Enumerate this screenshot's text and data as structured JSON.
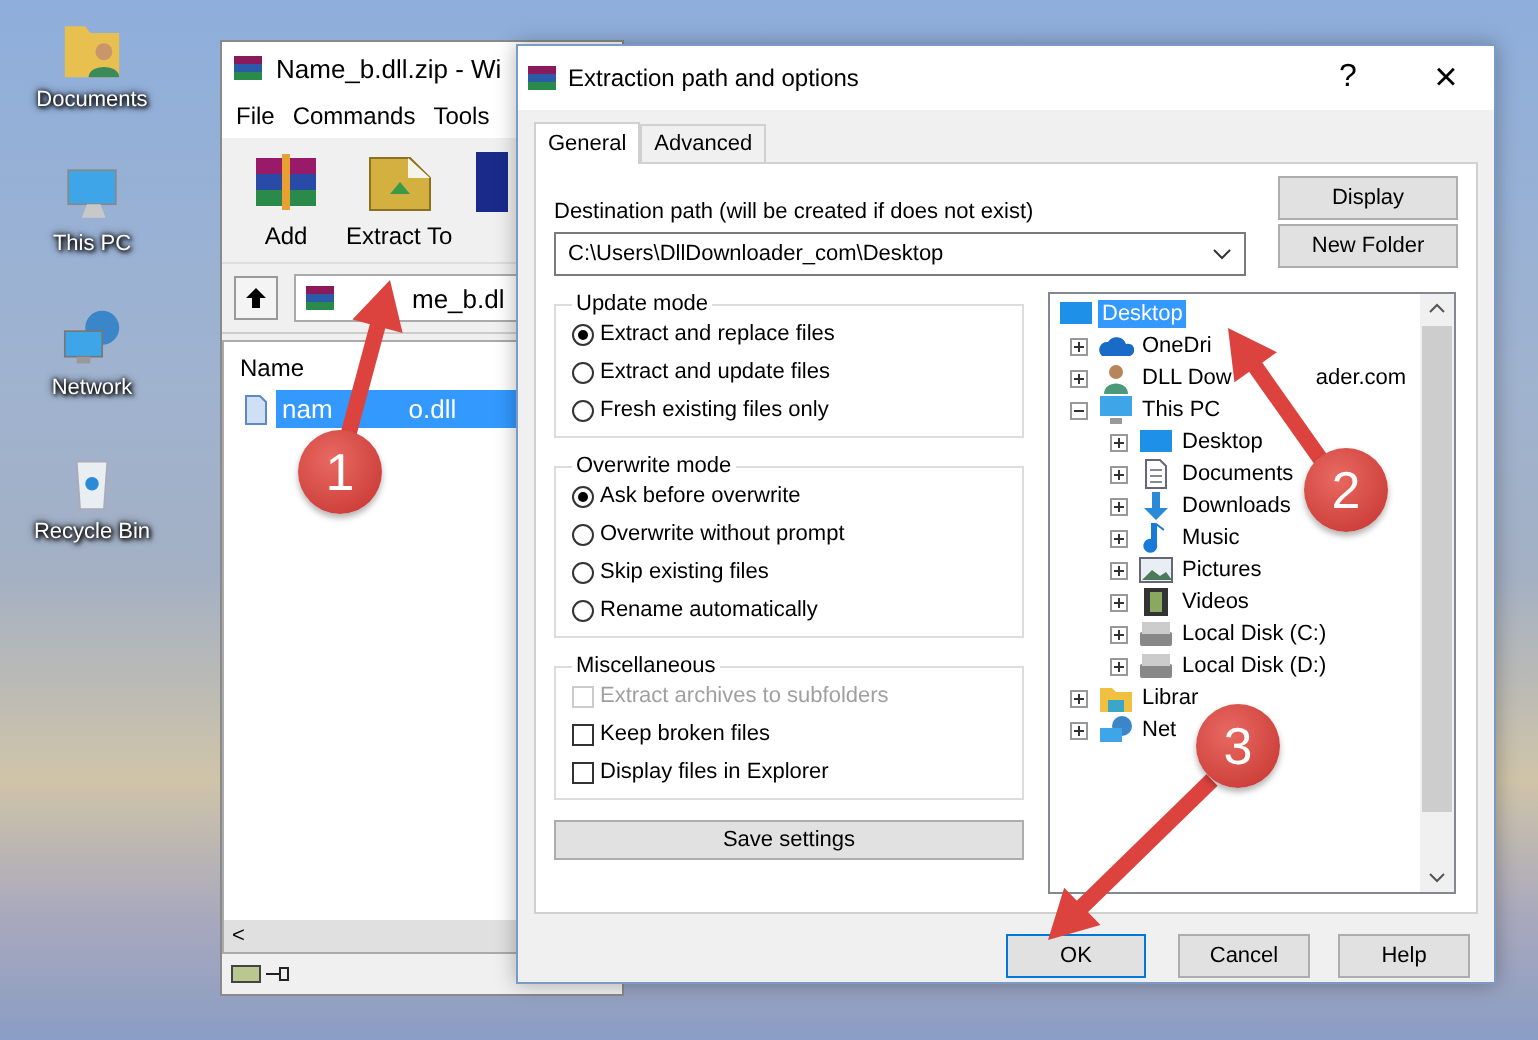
{
  "desktop_icons": [
    {
      "label": "Documents",
      "kind": "documents"
    },
    {
      "label": "This PC",
      "kind": "pc"
    },
    {
      "label": "Network",
      "kind": "network"
    },
    {
      "label": "Recycle Bin",
      "kind": "recycle"
    }
  ],
  "archiver": {
    "title": "Name_b.dll.zip - Wi",
    "menu": [
      "File",
      "Commands",
      "Tools"
    ],
    "toolbar": [
      {
        "label": "Add",
        "kind": "add"
      },
      {
        "label": "Extract To",
        "kind": "extract"
      },
      {
        "kind": "book"
      }
    ],
    "address": "me_b.dl",
    "column": "Name",
    "files": [
      {
        "name_start": "nam",
        "name_end": "o.dll",
        "selected": true
      }
    ],
    "scroll_left": "<"
  },
  "dialog": {
    "title": "Extraction path and options",
    "help": "?",
    "close": "×",
    "tabs": [
      {
        "label": "General",
        "selected": true
      },
      {
        "label": "Advanced",
        "selected": false
      }
    ],
    "destination_label": "Destination path (will be created if does not exist)",
    "destination_value": "C:\\Users\\DllDownloader_com\\Desktop",
    "side_buttons": [
      "Display",
      "New Folder"
    ],
    "groups": [
      {
        "title": "Update mode",
        "kind": "radio",
        "options": [
          {
            "label": "Extract and replace files",
            "selected": true
          },
          {
            "label": "Extract and update files",
            "selected": false
          },
          {
            "label": "Fresh existing files only",
            "selected": false
          }
        ]
      },
      {
        "title": "Overwrite mode",
        "kind": "radio",
        "options": [
          {
            "label": "Ask before overwrite",
            "selected": true
          },
          {
            "label": "Overwrite without prompt",
            "selected": false
          },
          {
            "label": "Skip existing files",
            "selected": false
          },
          {
            "label": "Rename automatically",
            "selected": false
          }
        ]
      },
      {
        "title": "Miscellaneous",
        "kind": "checkbox",
        "options": [
          {
            "label": "Extract archives to subfolders",
            "checked": false,
            "disabled": true
          },
          {
            "label": "Keep broken files",
            "checked": false,
            "disabled": false
          },
          {
            "label": "Display files in Explorer",
            "checked": false,
            "disabled": false
          }
        ]
      }
    ],
    "save_button": "Save settings",
    "tree": [
      {
        "label": "Desktop",
        "kind": "desktop",
        "selected": true,
        "children": [
          {
            "label": "OneDri",
            "kind": "cloud",
            "selected": false,
            "expanded": false
          },
          {
            "label": "DLL Dow",
            "label_tail": "ader.com",
            "kind": "user",
            "selected": false,
            "expanded": false
          },
          {
            "label": "This PC",
            "kind": "pc",
            "selected": false,
            "expanded": true,
            "children": [
              {
                "label": "Desktop",
                "kind": "desktop",
                "selected": false,
                "expanded": false
              },
              {
                "label": "Documents",
                "kind": "documents",
                "selected": false,
                "expanded": false
              },
              {
                "label": "Downloads",
                "kind": "downloads",
                "selected": false,
                "expanded": false
              },
              {
                "label": "Music",
                "kind": "music",
                "selected": false,
                "expanded": false
              },
              {
                "label": "Pictures",
                "kind": "pictures",
                "selected": false,
                "expanded": false
              },
              {
                "label": "Videos",
                "kind": "videos",
                "selected": false,
                "expanded": false
              },
              {
                "label": "Local Disk (C:)",
                "kind": "disk",
                "selected": false,
                "expanded": false
              },
              {
                "label": "Local Disk (D:)",
                "kind": "disk",
                "selected": false,
                "expanded": false
              }
            ]
          },
          {
            "label": "Librar",
            "kind": "libraries",
            "selected": false,
            "expanded": false
          },
          {
            "label": "Net",
            "kind": "network",
            "selected": false,
            "expanded": false
          }
        ]
      }
    ],
    "footer_buttons": [
      {
        "label": "OK",
        "default": true
      },
      {
        "label": "Cancel",
        "default": false
      },
      {
        "label": "Help",
        "default": false
      }
    ]
  },
  "annotations": [
    {
      "number": "1"
    },
    {
      "number": "2"
    },
    {
      "number": "3"
    }
  ]
}
